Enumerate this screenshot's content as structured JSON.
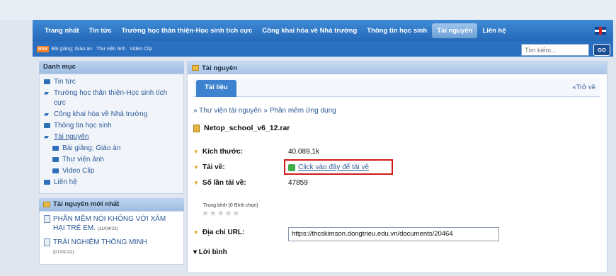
{
  "nav": {
    "items": [
      {
        "label": "Trang nhất"
      },
      {
        "label": "Tin tức"
      },
      {
        "label": "Trường học thân thiện-Học sinh tích cực"
      },
      {
        "label": "Công khai hóa về Nhà trường"
      },
      {
        "label": "Thông tin học sinh"
      },
      {
        "label": "Tài nguyên",
        "active": true
      },
      {
        "label": "Liên hệ"
      }
    ],
    "flag": "uk-flag-icon"
  },
  "subbar": {
    "rss": "RSS",
    "items": [
      "Bài giảng; Giáo án",
      "Thư viện ảnh",
      "Video Clip"
    ]
  },
  "search": {
    "placeholder": "Tìm kiếm...",
    "button": "GO"
  },
  "sidebar": {
    "title": "Danh mục",
    "items": [
      {
        "label": "Tin tức"
      },
      {
        "label": "Trường học thân thiện-Học sinh tích cực"
      },
      {
        "label": "Công khai hóa về Nhà trường"
      },
      {
        "label": "Thông tin học sinh"
      },
      {
        "label": "Tài nguyên"
      },
      {
        "label": "Bài giảng; Giáo án"
      },
      {
        "label": "Thư viện ảnh"
      },
      {
        "label": "Video Clip"
      },
      {
        "label": "Liên hệ"
      }
    ]
  },
  "new_resources": {
    "title": "Tài nguyên mới nhất",
    "items": [
      {
        "label": "PHẦN MỀM NÓI KHÔNG VỚI XÂM HẠI TRẺ EM.",
        "date": "(11/04/23)"
      },
      {
        "label": "TRẢI NGHIỆM THÔNG MINH",
        "date": "(07/01/22)"
      }
    ]
  },
  "main": {
    "header": "Tài nguyên",
    "tab": "Tài liệu",
    "back": "«Trở về",
    "breadcrumb": [
      "Thư viện tài nguyên",
      "Phần mềm ứng dụng"
    ],
    "file_name": "Netop_school_v6_12.rar",
    "size_label": "Kích thước:",
    "size_value": "40.089,1k",
    "download_label": "Tải về:",
    "download_link": "Click vào đây để tải về",
    "count_label": "Số lần tải về:",
    "count_value": "47859",
    "rating_label": "Trung bình (0 Bình chọn)",
    "rating_stars": 0,
    "rating_max": 5,
    "url_label": "Địa chỉ URL:",
    "url_value": "https://thcskimson.dongtrieu.edu.vn/documents/20464",
    "comments_label": "▾ Lời bình"
  },
  "colors": {
    "nav": "#2a6fc0",
    "highlight": "#d21a1a",
    "link": "#2d5a97"
  }
}
